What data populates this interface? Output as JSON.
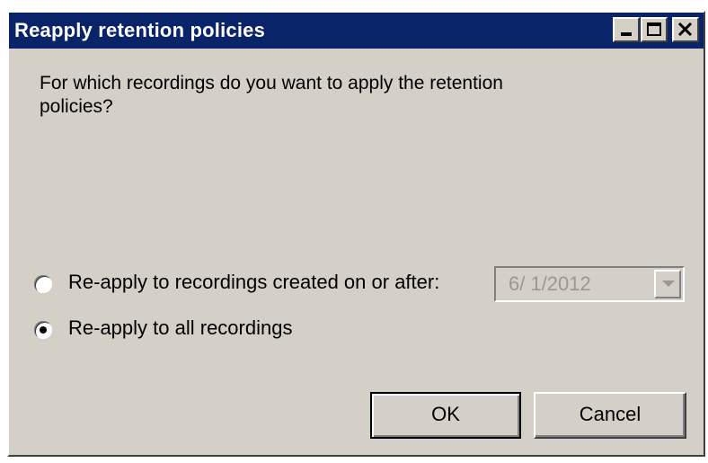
{
  "window": {
    "title": "Reapply retention policies"
  },
  "dialog": {
    "prompt": "For which recordings do you want to apply the retention policies?",
    "options": [
      {
        "label": "Re-apply to recordings created on or after:",
        "selected": false
      },
      {
        "label": "Re-apply to all recordings",
        "selected": true
      }
    ],
    "date_picker": {
      "value": "6/ 1/2012",
      "enabled": false
    },
    "buttons": {
      "ok_label": "OK",
      "cancel_label": "Cancel"
    }
  },
  "colors": {
    "titlebar": "#0a246a",
    "face": "#d4d0c8",
    "disabled_text": "#9a9890"
  }
}
